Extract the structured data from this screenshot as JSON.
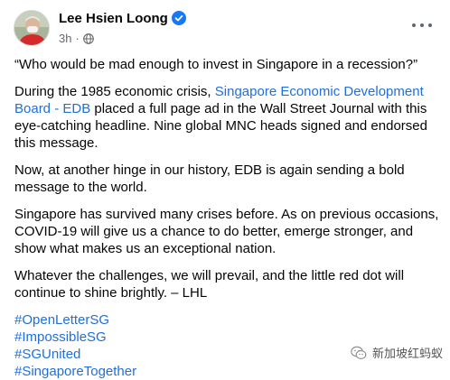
{
  "post": {
    "author": "Lee Hsien Loong",
    "timestamp": "3h",
    "separator": "·",
    "icons": {
      "verified": "verified-badge-icon",
      "audience": "globe-icon",
      "menu": "more-options-icon"
    },
    "colors": {
      "link": "#216fdb",
      "verified": "#1877f2",
      "meta": "#65676b"
    },
    "paragraphs": {
      "p1": "“Who would be mad enough to invest in Singapore in a recession?”",
      "p2_before": "During the 1985 economic crisis, ",
      "p2_link": "Singapore Economic Development Board - EDB",
      "p2_after": " placed a full page ad in the Wall Street Journal with this eye-catching headline. Nine global MNC heads signed and endorsed this message.",
      "p3": "Now, at another hinge in our history, EDB is again sending a bold message to the world.",
      "p4": "Singapore has survived many crises before. As on previous occasions, COVID-19 will give us a chance to do better, emerge stronger, and show what makes us an exceptional nation.",
      "p5": "Whatever the challenges, we will prevail, and the little red dot will continue to shine brightly. – LHL"
    },
    "hashtags": [
      "#OpenLetterSG",
      "#ImpossibleSG",
      "#SGUnited",
      "#SingaporeTogether"
    ]
  },
  "watermark": {
    "text": "新加坡红蚂蚁",
    "icon": "wechat-logo-icon"
  }
}
